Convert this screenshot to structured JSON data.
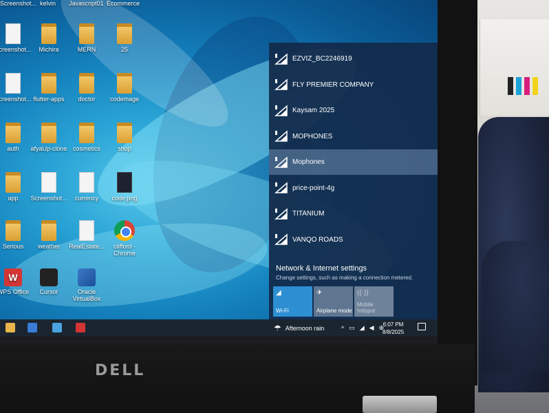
{
  "desktop": {
    "top_row": [
      "Screenshot...",
      "kelvin",
      "Javascript01",
      "Ecommerce"
    ],
    "icons": [
      {
        "label": "Screenshot...",
        "type": "doc"
      },
      {
        "label": "Michira",
        "type": "folder"
      },
      {
        "label": "MERN",
        "type": "folder"
      },
      {
        "label": "25",
        "type": "folder"
      },
      {
        "label": "Screenshot...",
        "type": "doc"
      },
      {
        "label": "flutter-apps",
        "type": "folder"
      },
      {
        "label": "doctor",
        "type": "folder"
      },
      {
        "label": "codemage",
        "type": "folder"
      },
      {
        "label": "auth",
        "type": "folder"
      },
      {
        "label": "afyaUp-clone",
        "type": "folder"
      },
      {
        "label": "cosmetics",
        "type": "folder"
      },
      {
        "label": "shop",
        "type": "folder"
      },
      {
        "label": "app",
        "type": "folder"
      },
      {
        "label": "Screenshot...",
        "type": "doc"
      },
      {
        "label": "currency",
        "type": "doc"
      },
      {
        "label": "code.png",
        "type": "dark"
      },
      {
        "label": "Serious",
        "type": "folder"
      },
      {
        "label": "weather",
        "type": "folder"
      },
      {
        "label": "RealEstate...",
        "type": "doc"
      },
      {
        "label": "clifford - Chrome",
        "type": "chrome"
      },
      {
        "label": "WPS Office",
        "type": "wps"
      },
      {
        "label": "Cursor",
        "type": "cursor"
      },
      {
        "label": "Oracle VirtualBox",
        "type": "vbox"
      }
    ]
  },
  "network_flyout": {
    "networks": [
      "EZVIZ_BC2246919",
      "FLY PREMIER COMPANY",
      "Kaysam 2025",
      "MOPHONES",
      "Mophones",
      "price-point-4g",
      "TITANIUM",
      "VANQO ROADS"
    ],
    "highlighted_network": "Mophones",
    "settings_title": "Network & Internet settings",
    "settings_subtitle": "Change settings, such as making a connection metered.",
    "tiles": {
      "wifi": "Wi-Fi",
      "airplane": "Airplane mode",
      "hotspot": "Mobile hotspot"
    }
  },
  "taskbar": {
    "weather": "Afternoon rain",
    "time": "6:07 PM",
    "date": "8/8/2025"
  },
  "hardware": {
    "brand": "DELL"
  }
}
